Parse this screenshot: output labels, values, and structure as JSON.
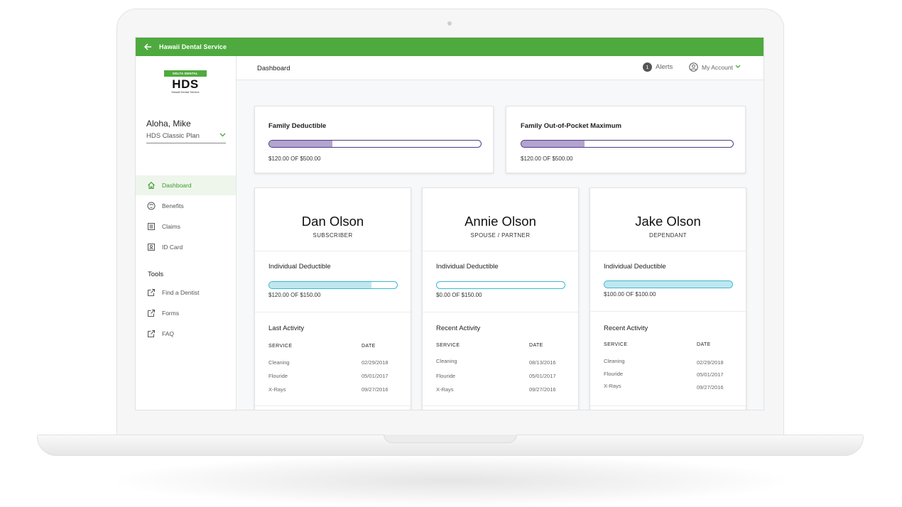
{
  "app": {
    "title": "Hawaii Dental Service"
  },
  "logo": {
    "brand": "DELTA DENTAL",
    "name": "HDS",
    "sub": "Hawaii Dental Service"
  },
  "user": {
    "greeting": "Aloha, Mike",
    "plan": "HDS Classic Plan"
  },
  "nav": {
    "items": [
      {
        "label": "Dashboard",
        "icon": "home-icon",
        "active": true
      },
      {
        "label": "Benefits",
        "icon": "tooth-icon"
      },
      {
        "label": "Claims",
        "icon": "list-icon"
      },
      {
        "label": "ID Card",
        "icon": "id-card-icon"
      }
    ],
    "tools_label": "Tools",
    "tools": [
      {
        "label": "Find a Dentist",
        "icon": "external-link-icon"
      },
      {
        "label": "Forms",
        "icon": "external-link-icon"
      },
      {
        "label": "FAQ",
        "icon": "external-link-icon"
      }
    ]
  },
  "header": {
    "breadcrumb": "Dashboard",
    "alerts_count": "1",
    "alerts_label": "Alerts",
    "account_label": "My Account"
  },
  "family": [
    {
      "title": "Family Deductible",
      "progress": 0.3,
      "label": "$120.00 OF $500.00"
    },
    {
      "title": "Family Out-of-Pocket Maximum",
      "progress": 0.3,
      "label": "$120.00 OF $500.00"
    }
  ],
  "members": [
    {
      "name": "Dan Olson",
      "role": "SUBSCRIBER",
      "deductible_title": "Individual Deductible",
      "progress": 0.8,
      "deductible_label": "$120.00 OF $150.00",
      "activity_title": "Last Activity",
      "headers": [
        "SERVICE",
        "DATE"
      ],
      "rows": [
        [
          "Cleaning",
          "02/29/2018"
        ],
        [
          "Flouride",
          "05/01/2017"
        ],
        [
          "X-Rays",
          "09/27/2016"
        ]
      ]
    },
    {
      "name": "Annie Olson",
      "role": "SPOUSE / PARTNER",
      "deductible_title": "Individual Deductible",
      "progress": 0.0,
      "deductible_label": "$0.00 OF $150.00",
      "activity_title": "Recent Activity",
      "headers": [
        "SERVICE",
        "DATE"
      ],
      "rows": [
        [
          "Cleaning",
          "08/13/2016"
        ],
        [
          "Flouride",
          "05/01/2017"
        ],
        [
          "X-Rays",
          "09/27/2016"
        ]
      ]
    },
    {
      "name": "Jake Olson",
      "role": "DEPENDANT",
      "deductible_title": "Individual Deductible",
      "progress": 1.0,
      "deductible_label": "$100.00 OF $100.00",
      "activity_title": "Recent Activity",
      "headers": [
        "SERVICE",
        "DATE"
      ],
      "rows": [
        [
          "Cleaning",
          "02/29/2018"
        ],
        [
          "Flouride",
          "05/01/2017"
        ],
        [
          "X-Rays",
          "09/27/2016"
        ]
      ]
    }
  ],
  "colors": {
    "brand_green": "#4eaa3e",
    "family_bar": "#4a3d85",
    "member_bar": "#3bb8d0"
  }
}
